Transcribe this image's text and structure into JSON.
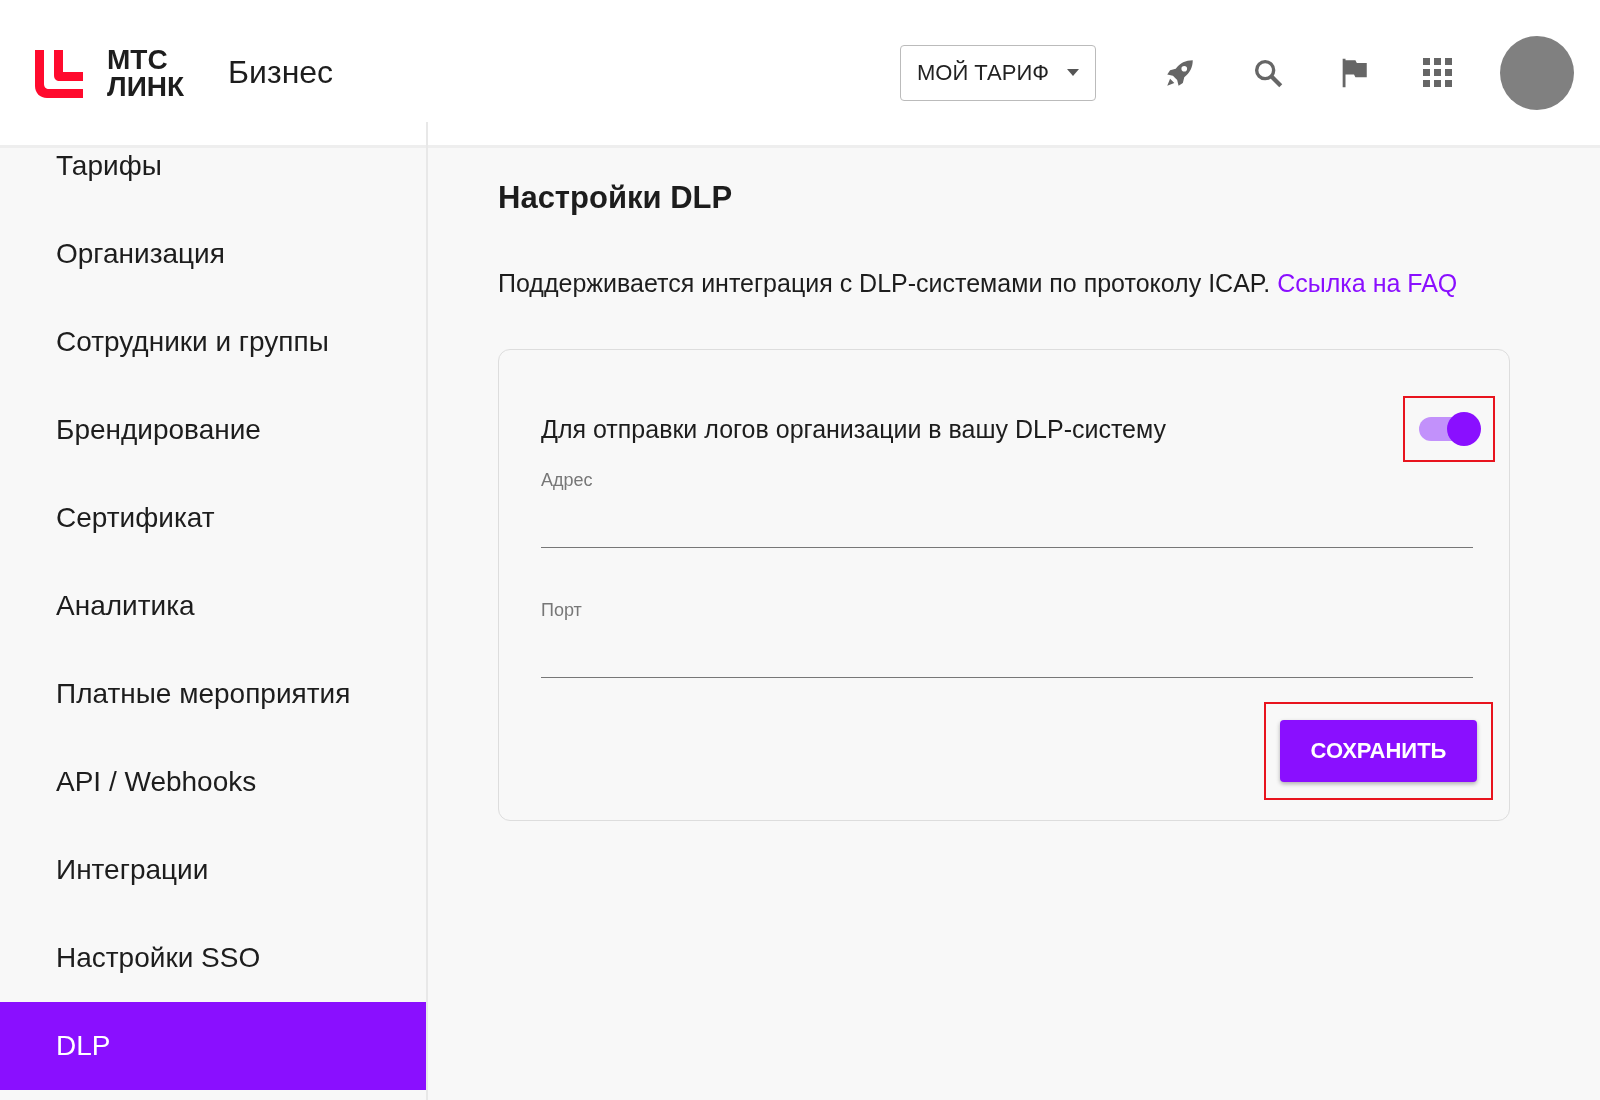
{
  "header": {
    "logo_text": [
      "МТС",
      "ЛИНК"
    ],
    "product": "Бизнес",
    "tariff_button": "МОЙ ТАРИФ"
  },
  "sidebar": {
    "items": [
      {
        "label": "Тарифы",
        "selected": false
      },
      {
        "label": "Организация",
        "selected": false
      },
      {
        "label": "Сотрудники и группы",
        "selected": false
      },
      {
        "label": "Брендирование",
        "selected": false
      },
      {
        "label": "Сертификат",
        "selected": false
      },
      {
        "label": "Аналитика",
        "selected": false
      },
      {
        "label": "Платные мероприятия",
        "selected": false
      },
      {
        "label": "API / Webhooks",
        "selected": false
      },
      {
        "label": "Интеграции",
        "selected": false
      },
      {
        "label": "Настройки SSO",
        "selected": false
      },
      {
        "label": "DLP",
        "selected": true
      }
    ]
  },
  "content": {
    "title": "Настройки DLP",
    "description": "Поддерживается интеграция с DLP-системами по протоколу ICAP.",
    "link": "Ссылка на FAQ",
    "card": {
      "toggle_label": "Для отправки логов организации в вашу DLP-систему",
      "toggle": {
        "on": true,
        "highlighted": true
      },
      "fields": [
        {
          "label": "Адрес"
        },
        {
          "label": "Порт"
        }
      ],
      "save_button": {
        "label": "СОХРАНИТЬ",
        "highlighted": true
      }
    }
  }
}
